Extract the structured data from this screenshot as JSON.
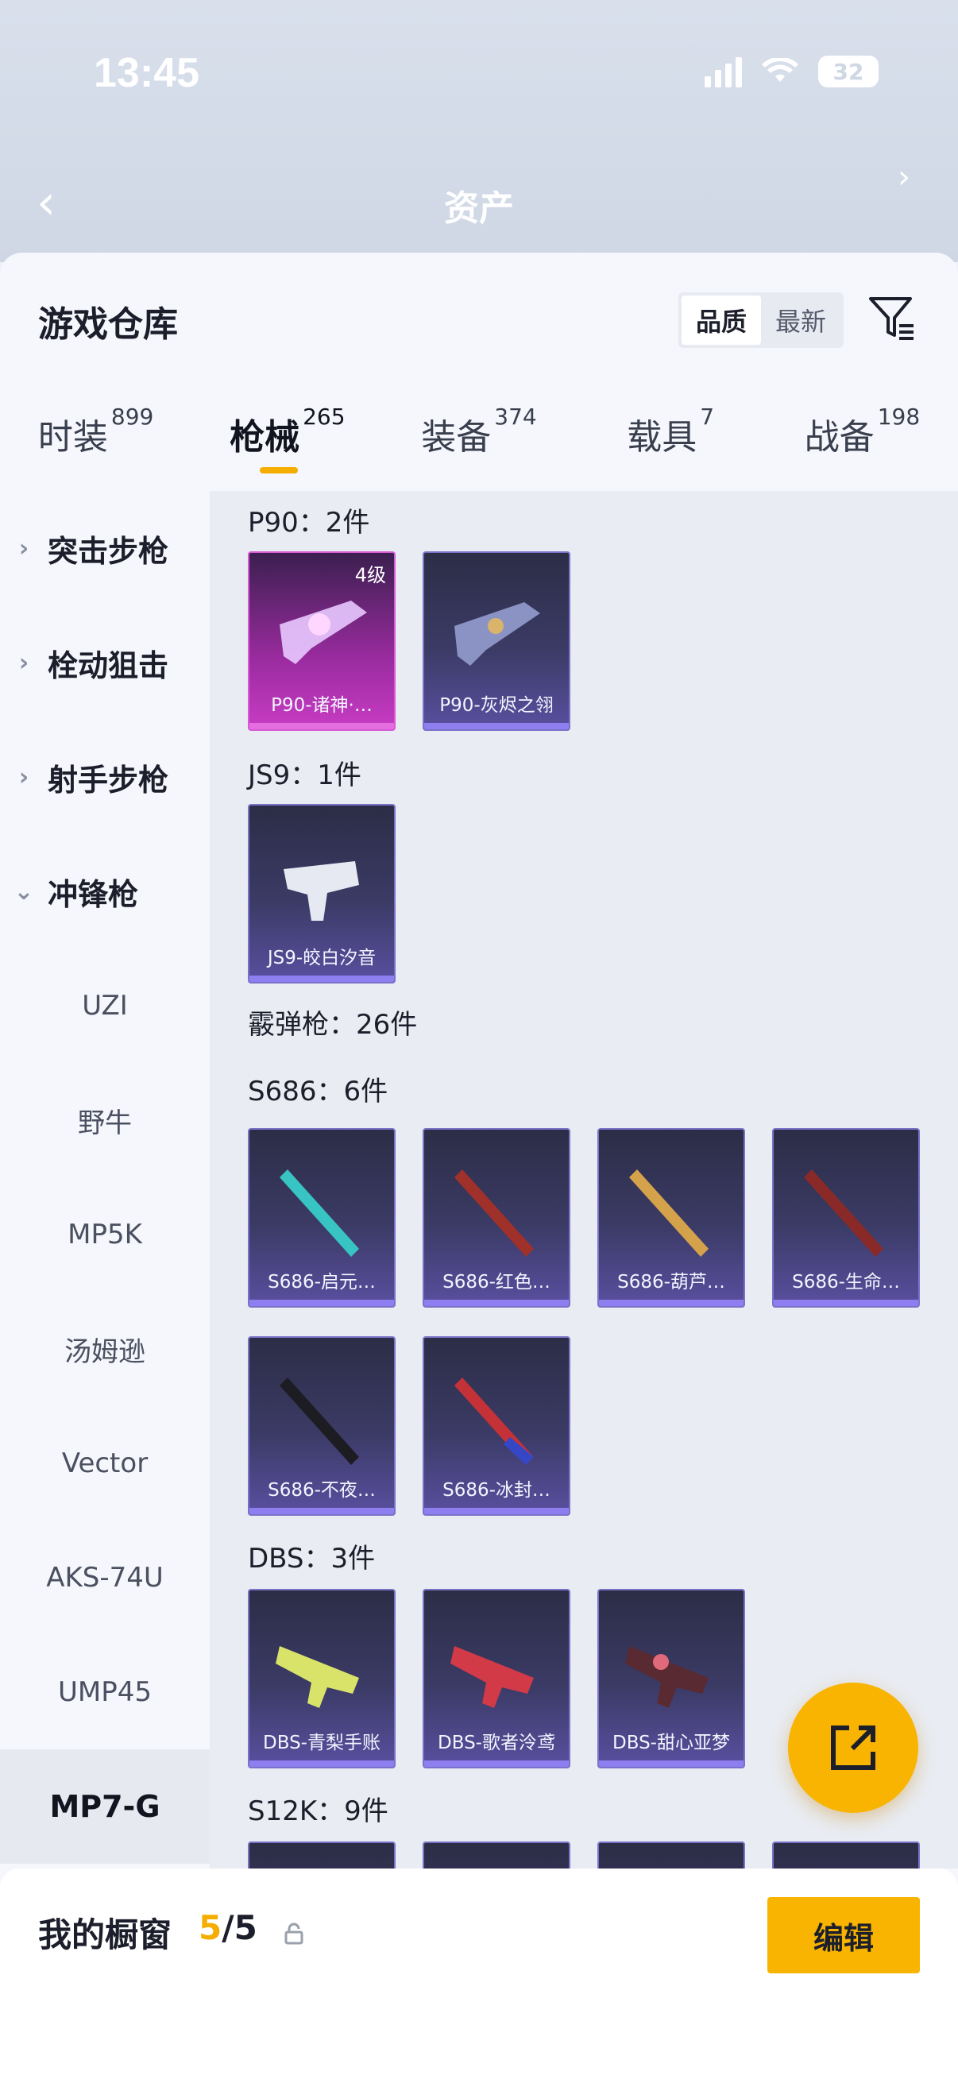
{
  "status": {
    "time": "13:45",
    "battery": "32"
  },
  "header": {
    "title": "资产"
  },
  "sheet": {
    "title": "游戏仓库",
    "sort": [
      "品质",
      "最新"
    ]
  },
  "tabs": [
    {
      "label": "时装",
      "count": "899"
    },
    {
      "label": "枪械",
      "count": "265"
    },
    {
      "label": "装备",
      "count": "374"
    },
    {
      "label": "载具",
      "count": "7"
    },
    {
      "label": "战备",
      "count": "198"
    }
  ],
  "sidebar": {
    "categories": [
      "突击步枪",
      "栓动狙击",
      "射手步枪",
      "冲锋枪"
    ],
    "subs": [
      "UZI",
      "野牛",
      "MP5K",
      "汤姆逊",
      "Vector",
      "AKS-74U",
      "UMP45",
      "MP7-G"
    ]
  },
  "sections": {
    "p90": {
      "title": "P90：2件",
      "items": [
        "P90-诸神·…",
        "P90-灰烬之翎"
      ],
      "level": "4级"
    },
    "js9": {
      "title": "JS9：1件",
      "items": [
        "JS9-皎白汐音"
      ]
    },
    "shotgun": {
      "title": "霰弹枪：26件"
    },
    "s686": {
      "title": "S686：6件",
      "items": [
        "S686-启元…",
        "S686-红色…",
        "S686-葫芦…",
        "S686-生命…",
        "S686-不夜…",
        "S686-冰封…"
      ]
    },
    "dbs": {
      "title": "DBS：3件",
      "items": [
        "DBS-青梨手账",
        "DBS-歌者泠鸢",
        "DBS-甜心亚梦"
      ]
    },
    "s12k": {
      "title": "S12K：9件"
    }
  },
  "bottom": {
    "label": "我的橱窗",
    "current": "5",
    "sep": "/",
    "total": "5",
    "edit": "编辑"
  },
  "colors": {
    "accent": "#f8b400",
    "card_purple": "#5a4fa0",
    "card_pink": "#c83cc4"
  }
}
